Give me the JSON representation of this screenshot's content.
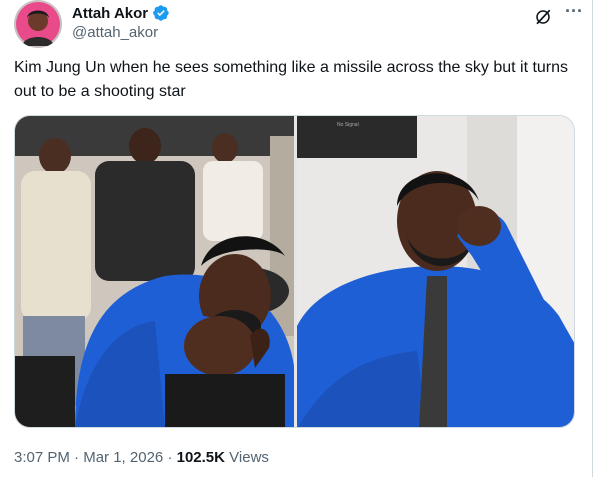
{
  "author": {
    "name": "Attah Akor",
    "handle": "@attah_akor",
    "verified": true,
    "avatar_icon": "avatar-portrait"
  },
  "actions": {
    "grok_icon": "grok-icon",
    "more_label": "···"
  },
  "tweet": {
    "text": "Kim Jung Un when he sees something like a missile across the sky but it turns out to be a shooting star"
  },
  "media": {
    "left_image": "man-in-blue-shirt-clenching-fist",
    "right_image": "man-in-blue-shirt-biting-fist",
    "tv_text": "No Signal"
  },
  "meta": {
    "time": "3:07 PM",
    "separator": "·",
    "date": "Mar 1, 2026",
    "views_count": "102.5K",
    "views_label": "Views"
  },
  "colors": {
    "text_primary": "#0f1419",
    "text_secondary": "#536471",
    "verified_blue": "#1d9bf0",
    "border": "#cfd9de",
    "shirt_blue": "#1f5fd6"
  }
}
